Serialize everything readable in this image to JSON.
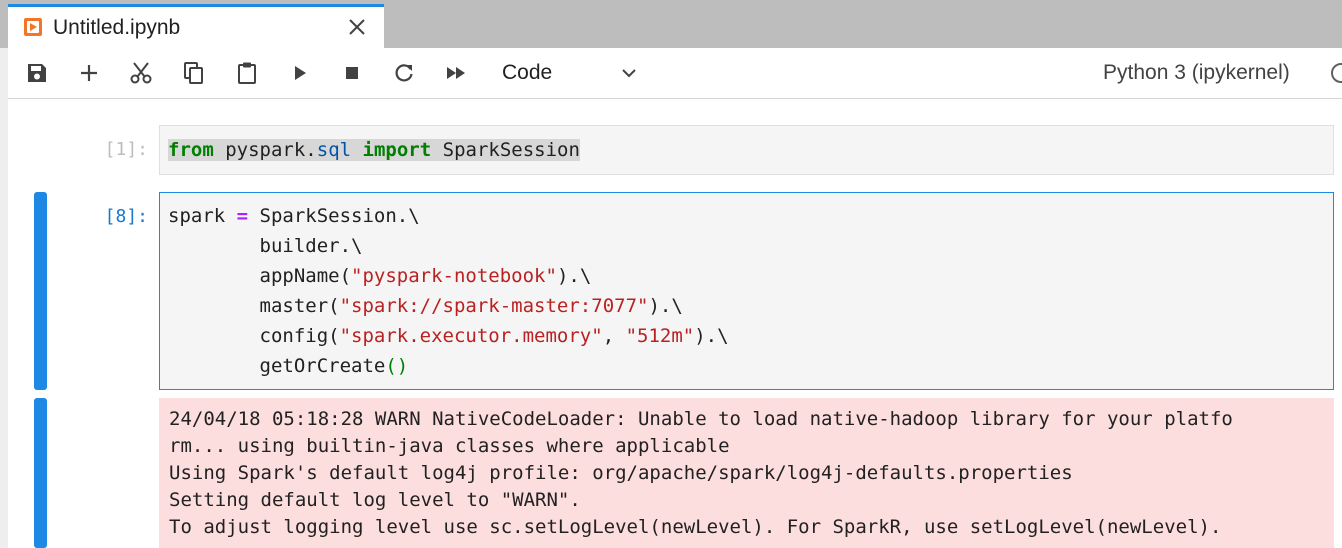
{
  "tab": {
    "title": "Untitled.ipynb"
  },
  "toolbar": {
    "cell_type": "Code",
    "kernel": "Python 3 (ipykernel)"
  },
  "cells": [
    {
      "prompt": "[1]:",
      "tokens": [
        {
          "t": "from",
          "c": "kw"
        },
        {
          "t": " ",
          "c": ""
        },
        {
          "t": "pyspark",
          "c": ""
        },
        {
          "t": ".",
          "c": ""
        },
        {
          "t": "sql",
          "c": "mod"
        },
        {
          "t": " ",
          "c": ""
        },
        {
          "t": "import",
          "c": "kw"
        },
        {
          "t": " ",
          "c": ""
        },
        {
          "t": "SparkSession",
          "c": ""
        }
      ]
    },
    {
      "prompt": "[8]:",
      "lines": [
        [
          {
            "t": "spark ",
            "c": ""
          },
          {
            "t": "=",
            "c": "op"
          },
          {
            "t": " SparkSession.\\",
            "c": ""
          }
        ],
        [
          {
            "t": "        builder.\\",
            "c": ""
          }
        ],
        [
          {
            "t": "        appName(",
            "c": ""
          },
          {
            "t": "\"pyspark-notebook\"",
            "c": "str"
          },
          {
            "t": ").\\",
            "c": ""
          }
        ],
        [
          {
            "t": "        master(",
            "c": ""
          },
          {
            "t": "\"spark://spark-master:7077\"",
            "c": "str"
          },
          {
            "t": ").\\",
            "c": ""
          }
        ],
        [
          {
            "t": "        config(",
            "c": ""
          },
          {
            "t": "\"spark.executor.memory\"",
            "c": "str"
          },
          {
            "t": ", ",
            "c": ""
          },
          {
            "t": "\"512m\"",
            "c": "str"
          },
          {
            "t": ").\\",
            "c": ""
          }
        ],
        [
          {
            "t": "        getOrCreate",
            "c": ""
          },
          {
            "t": "()",
            "c": "paren"
          }
        ]
      ],
      "output": [
        "24/04/18 05:18:28 WARN NativeCodeLoader: Unable to load native-hadoop library for your platfo",
        "rm... using builtin-java classes where applicable",
        "Using Spark's default log4j profile: org/apache/spark/log4j-defaults.properties",
        "Setting default log level to \"WARN\".",
        "To adjust logging level use sc.setLogLevel(newLevel). For SparkR, use setLogLevel(newLevel)."
      ]
    }
  ],
  "icons": {
    "tab": "notebook-icon",
    "close": "close-icon",
    "save": "save-icon",
    "insert": "plus-icon",
    "cut": "scissors-icon",
    "copy": "copy-icon",
    "paste": "paste-icon",
    "run": "play-icon",
    "interrupt": "stop-icon",
    "restart": "refresh-icon",
    "restart_run_all": "fast-forward-icon",
    "dropdown": "chevron-down-icon",
    "kernel_status": "circle-icon"
  },
  "colors": {
    "accent": "#1e88e5",
    "output_bg": "#fddede",
    "keyword": "#008000",
    "string": "#ba2121",
    "notebook_icon": "#f37626"
  }
}
